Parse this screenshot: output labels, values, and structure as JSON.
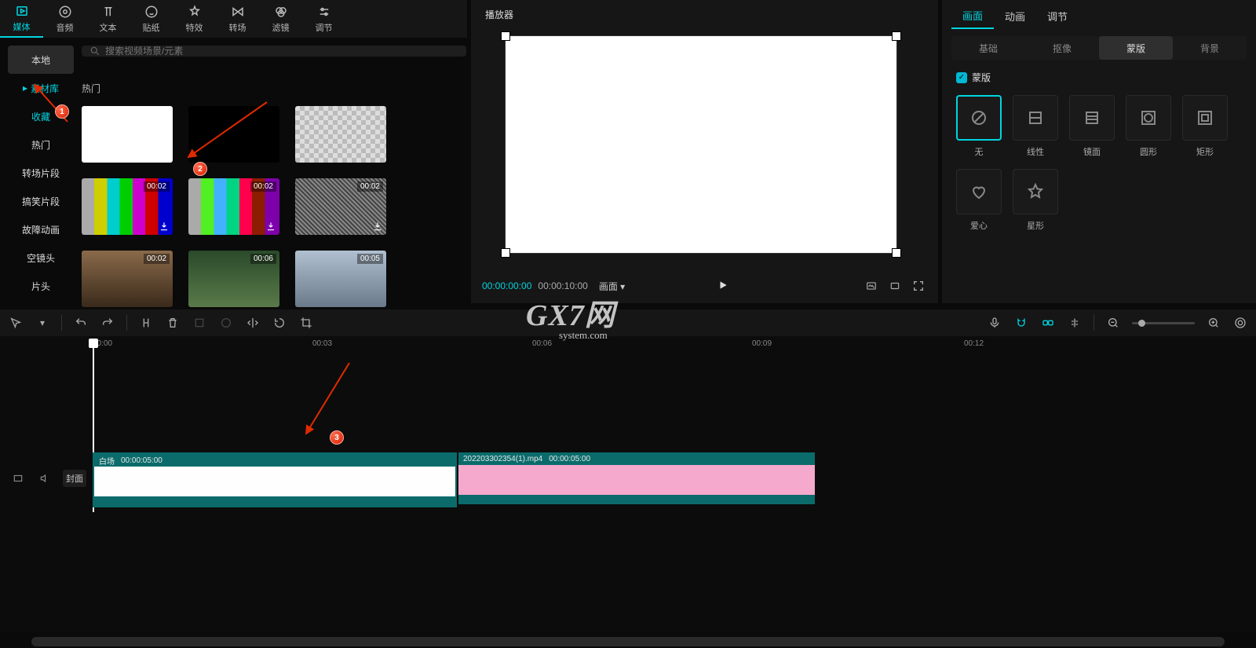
{
  "top_tabs": {
    "media": "媒体",
    "audio": "音频",
    "text": "文本",
    "sticker": "贴纸",
    "effect": "特效",
    "transition": "转场",
    "filter": "滤镜",
    "adjust": "调节"
  },
  "left_nav": {
    "local": "本地",
    "library": "素材库",
    "favorite": "收藏",
    "hot": "热门",
    "transition_seg": "转场片段",
    "funny_seg": "搞笑片段",
    "glitch": "故障动画",
    "empty_shot": "空镜头",
    "opener": "片头"
  },
  "search": {
    "placeholder": "搜索视频场景/元素"
  },
  "asset_section_title": "热门",
  "thumb_badges": {
    "d0002": "00:02",
    "d0006": "00:06",
    "d0005": "00:05"
  },
  "player": {
    "title": "播放器",
    "time_current": "00:00:00:00",
    "time_total": "00:00:10:00",
    "ratio_label": "画面"
  },
  "right": {
    "tabs": {
      "picture": "画面",
      "animation": "动画",
      "adjust": "调节"
    },
    "subtabs": {
      "basic": "基础",
      "cutout": "抠像",
      "mask": "蒙版",
      "background": "背景"
    },
    "mask_checkbox": "蒙版",
    "masks": {
      "none": "无",
      "linear": "线性",
      "mirror": "镜面",
      "circle": "圆形",
      "rect": "矩形",
      "heart": "爱心",
      "star": "星形"
    }
  },
  "timeline": {
    "ticks": {
      "t0": "00:00",
      "t3": "00:03",
      "t6": "00:06",
      "t9": "00:09",
      "t12": "00:12"
    },
    "cover_btn": "封面",
    "clip1": {
      "name": "白场",
      "duration": "00:00:05:00"
    },
    "clip2": {
      "name": "202203302354(1).mp4",
      "duration": "00:00:05:00"
    }
  },
  "watermark": {
    "brand": "GX7网",
    "sub": "system.com"
  },
  "annotation_numbers": {
    "n1": "1",
    "n2": "2",
    "n3": "3"
  }
}
